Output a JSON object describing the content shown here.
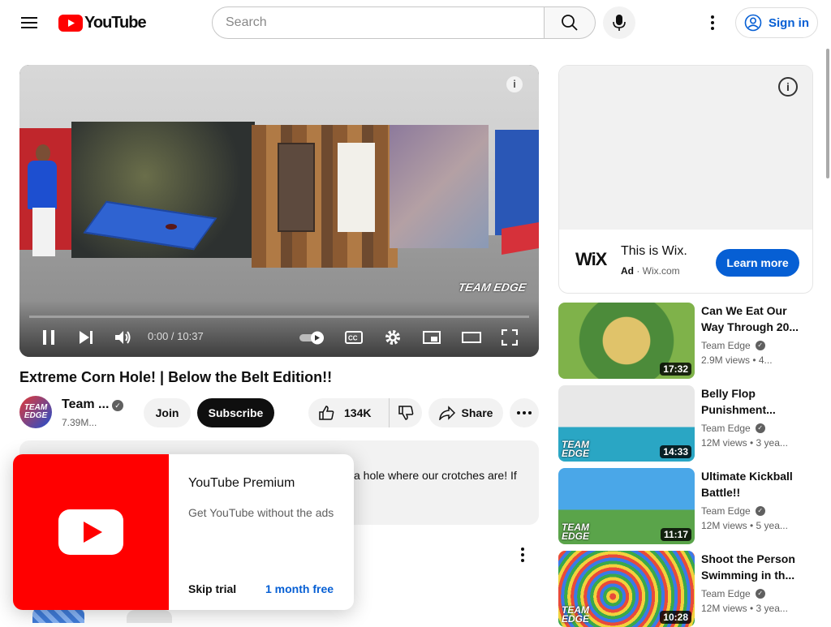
{
  "header": {
    "logo_text": "YouTube",
    "search_placeholder": "Search",
    "signin_label": "Sign in"
  },
  "player": {
    "time": "0:00 / 10:37",
    "watermark": "TEAM EDGE",
    "progress_fraction": 0.0
  },
  "ad": {
    "logo": "WiX",
    "title": "This is Wix.",
    "badge": "Ad",
    "domain": "Wix.com",
    "cta": "Learn more"
  },
  "video": {
    "title": "Extreme Corn Hole! | Below the Belt Edition!!",
    "channel_name": "Team ...",
    "subscribers": "7.39M...",
    "avatar_text": "TEAM EDGE",
    "join_label": "Join",
    "subscribe_label": "Subscribe",
    "likes": "134K",
    "share_label": "Share",
    "description_fragment": "a hole where our crotches are! If"
  },
  "premium_popup": {
    "title": "YouTube Premium",
    "subtitle": "Get YouTube without the ads",
    "skip_label": "Skip trial",
    "free_label": "1 month free"
  },
  "recommendations": [
    {
      "title": "Can We Eat Our Way Through 20...",
      "channel": "Team Edge",
      "meta": "2.9M views • 4...",
      "duration": "17:32"
    },
    {
      "title": "Belly Flop Punishment...",
      "channel": "Team Edge",
      "meta": "12M views • 3 yea...",
      "duration": "14:33"
    },
    {
      "title": "Ultimate Kickball Battle!!",
      "channel": "Team Edge",
      "meta": "12M views • 5 yea...",
      "duration": "11:17"
    },
    {
      "title": "Shoot the Person Swimming in th...",
      "channel": "Team Edge",
      "meta": "12M views • 3 yea...",
      "duration": "10:28"
    }
  ],
  "colors": {
    "brand_red": "#ff0000",
    "link_blue": "#065fd4",
    "text_primary": "#0f0f0f",
    "text_secondary": "#606060"
  }
}
